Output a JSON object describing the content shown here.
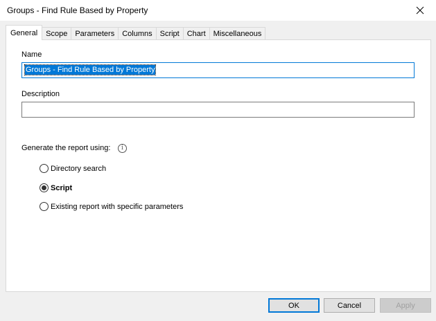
{
  "window": {
    "title": "Groups - Find Rule Based by Property",
    "close_icon": "close-icon"
  },
  "tabs": [
    {
      "label": "General",
      "active": true
    },
    {
      "label": "Scope"
    },
    {
      "label": "Parameters"
    },
    {
      "label": "Columns"
    },
    {
      "label": "Script"
    },
    {
      "label": "Chart"
    },
    {
      "label": "Miscellaneous"
    }
  ],
  "general": {
    "name_label": "Name",
    "name_value": "Groups - Find Rule Based by Property",
    "description_label": "Description",
    "description_value": "",
    "generate_label": "Generate the report using:",
    "info_icon": "info-icon",
    "options": [
      {
        "label": "Directory search",
        "checked": false
      },
      {
        "label": "Script",
        "checked": true
      },
      {
        "label": "Existing report with specific parameters",
        "checked": false
      }
    ]
  },
  "buttons": {
    "ok": "OK",
    "cancel": "Cancel",
    "apply": "Apply"
  },
  "colors": {
    "accent": "#0078d7"
  }
}
